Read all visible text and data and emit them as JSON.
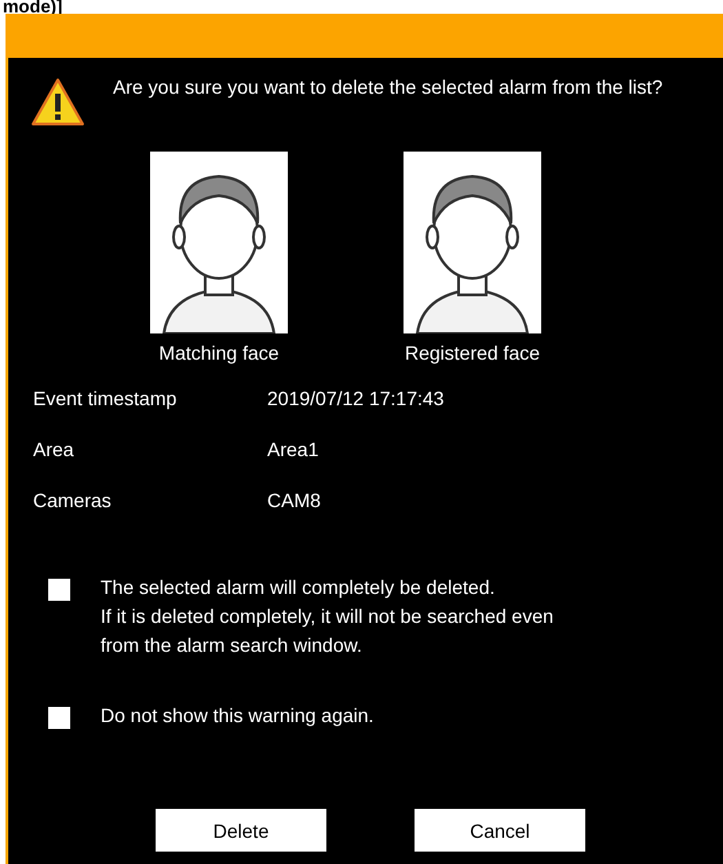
{
  "caption_fragment": "mode)]",
  "dialog": {
    "message": "Are you sure you want to delete the selected alarm from the list?",
    "faces": [
      {
        "kind": "picture",
        "label": "Matching face"
      },
      {
        "kind": "picture",
        "label": "Registered face"
      }
    ],
    "details": [
      {
        "label": "Event timestamp",
        "value": "2019/07/12 17:17:43"
      },
      {
        "label": "Area",
        "value": "Area1"
      },
      {
        "label": "Cameras",
        "value": "CAM8"
      }
    ],
    "options": [
      {
        "lines": [
          "The selected alarm will completely be deleted.",
          "If it is deleted completely, it will not be searched even",
          "from the alarm search window."
        ],
        "checked": false
      },
      {
        "lines": [
          "Do not show this warning again."
        ],
        "checked": false
      }
    ],
    "buttons": [
      "Delete",
      "Cancel"
    ]
  }
}
